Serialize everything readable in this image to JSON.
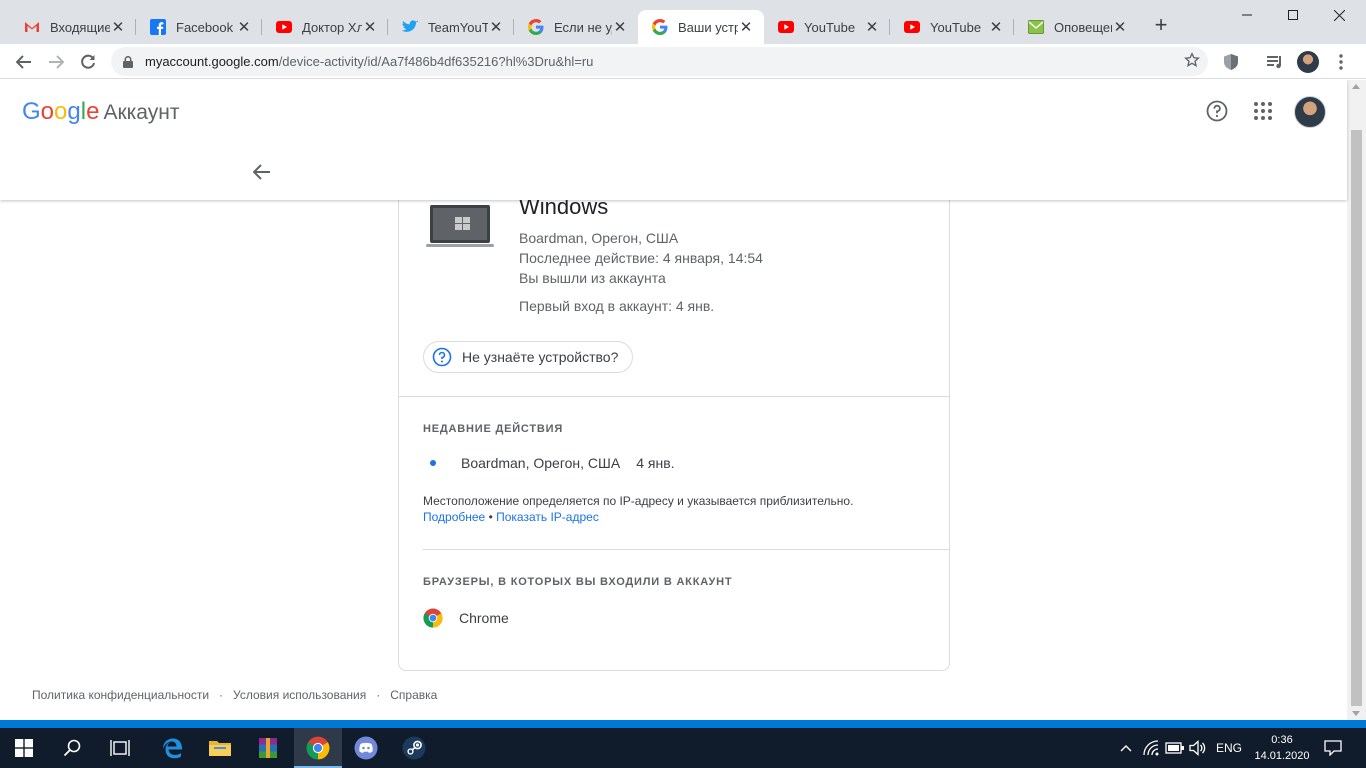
{
  "tabs": [
    {
      "title": "Входящие -",
      "icon": "gmail-icon"
    },
    {
      "title": "Facebook",
      "icon": "facebook-icon"
    },
    {
      "title": "Доктор Хлу",
      "icon": "youtube-icon"
    },
    {
      "title": "TeamYouTu",
      "icon": "twitter-icon"
    },
    {
      "title": "Если не уда",
      "icon": "google-icon"
    },
    {
      "title": "Ваши устро",
      "icon": "google-icon",
      "active": true
    },
    {
      "title": "YouTube",
      "icon": "youtube-icon"
    },
    {
      "title": "YouTube",
      "icon": "youtube-icon"
    },
    {
      "title": "Оповещен",
      "icon": "mail-icon"
    }
  ],
  "toolbar": {
    "url_host": "myaccount.google.com",
    "url_path": "/device-activity/id/Aa7f486b4df635216?hl%3Dru&hl=ru"
  },
  "header": {
    "logo_text": "Google",
    "product": "Аккаунт"
  },
  "device": {
    "name": "Windows",
    "location": "Boardman, Орегон, США",
    "last_activity": "Последнее действие: 4 января, 14:54",
    "status": "Вы вышли из аккаунта",
    "first_login": "Первый вход в аккаунт: 4 янв.",
    "unknown_device_label": "Не узнаёте устройство?"
  },
  "recent": {
    "title": "Недавние действия",
    "items": [
      {
        "location": "Boardman, Орегон, США",
        "date": "4 янв."
      }
    ],
    "note": "Местоположение определяется по IP-адресу и указывается приблизительно.",
    "more_link": "Подробнее",
    "link_separator": " • ",
    "ip_link": "Показать IP-адрес"
  },
  "browsers": {
    "title": "Браузеры, в которых вы входили в аккаунт",
    "items": [
      {
        "name": "Chrome",
        "icon": "chrome-icon"
      }
    ]
  },
  "footer": {
    "privacy": "Политика конфиденциальности",
    "separator": "·",
    "terms": "Условия использования",
    "help": "Справка"
  },
  "taskbar": {
    "language": "ENG",
    "time": "0:36",
    "date": "14.01.2020"
  },
  "colors": {
    "accent": "#1a73e8",
    "taskbar": "#101b2b",
    "tabstrip": "#dee1e6"
  }
}
